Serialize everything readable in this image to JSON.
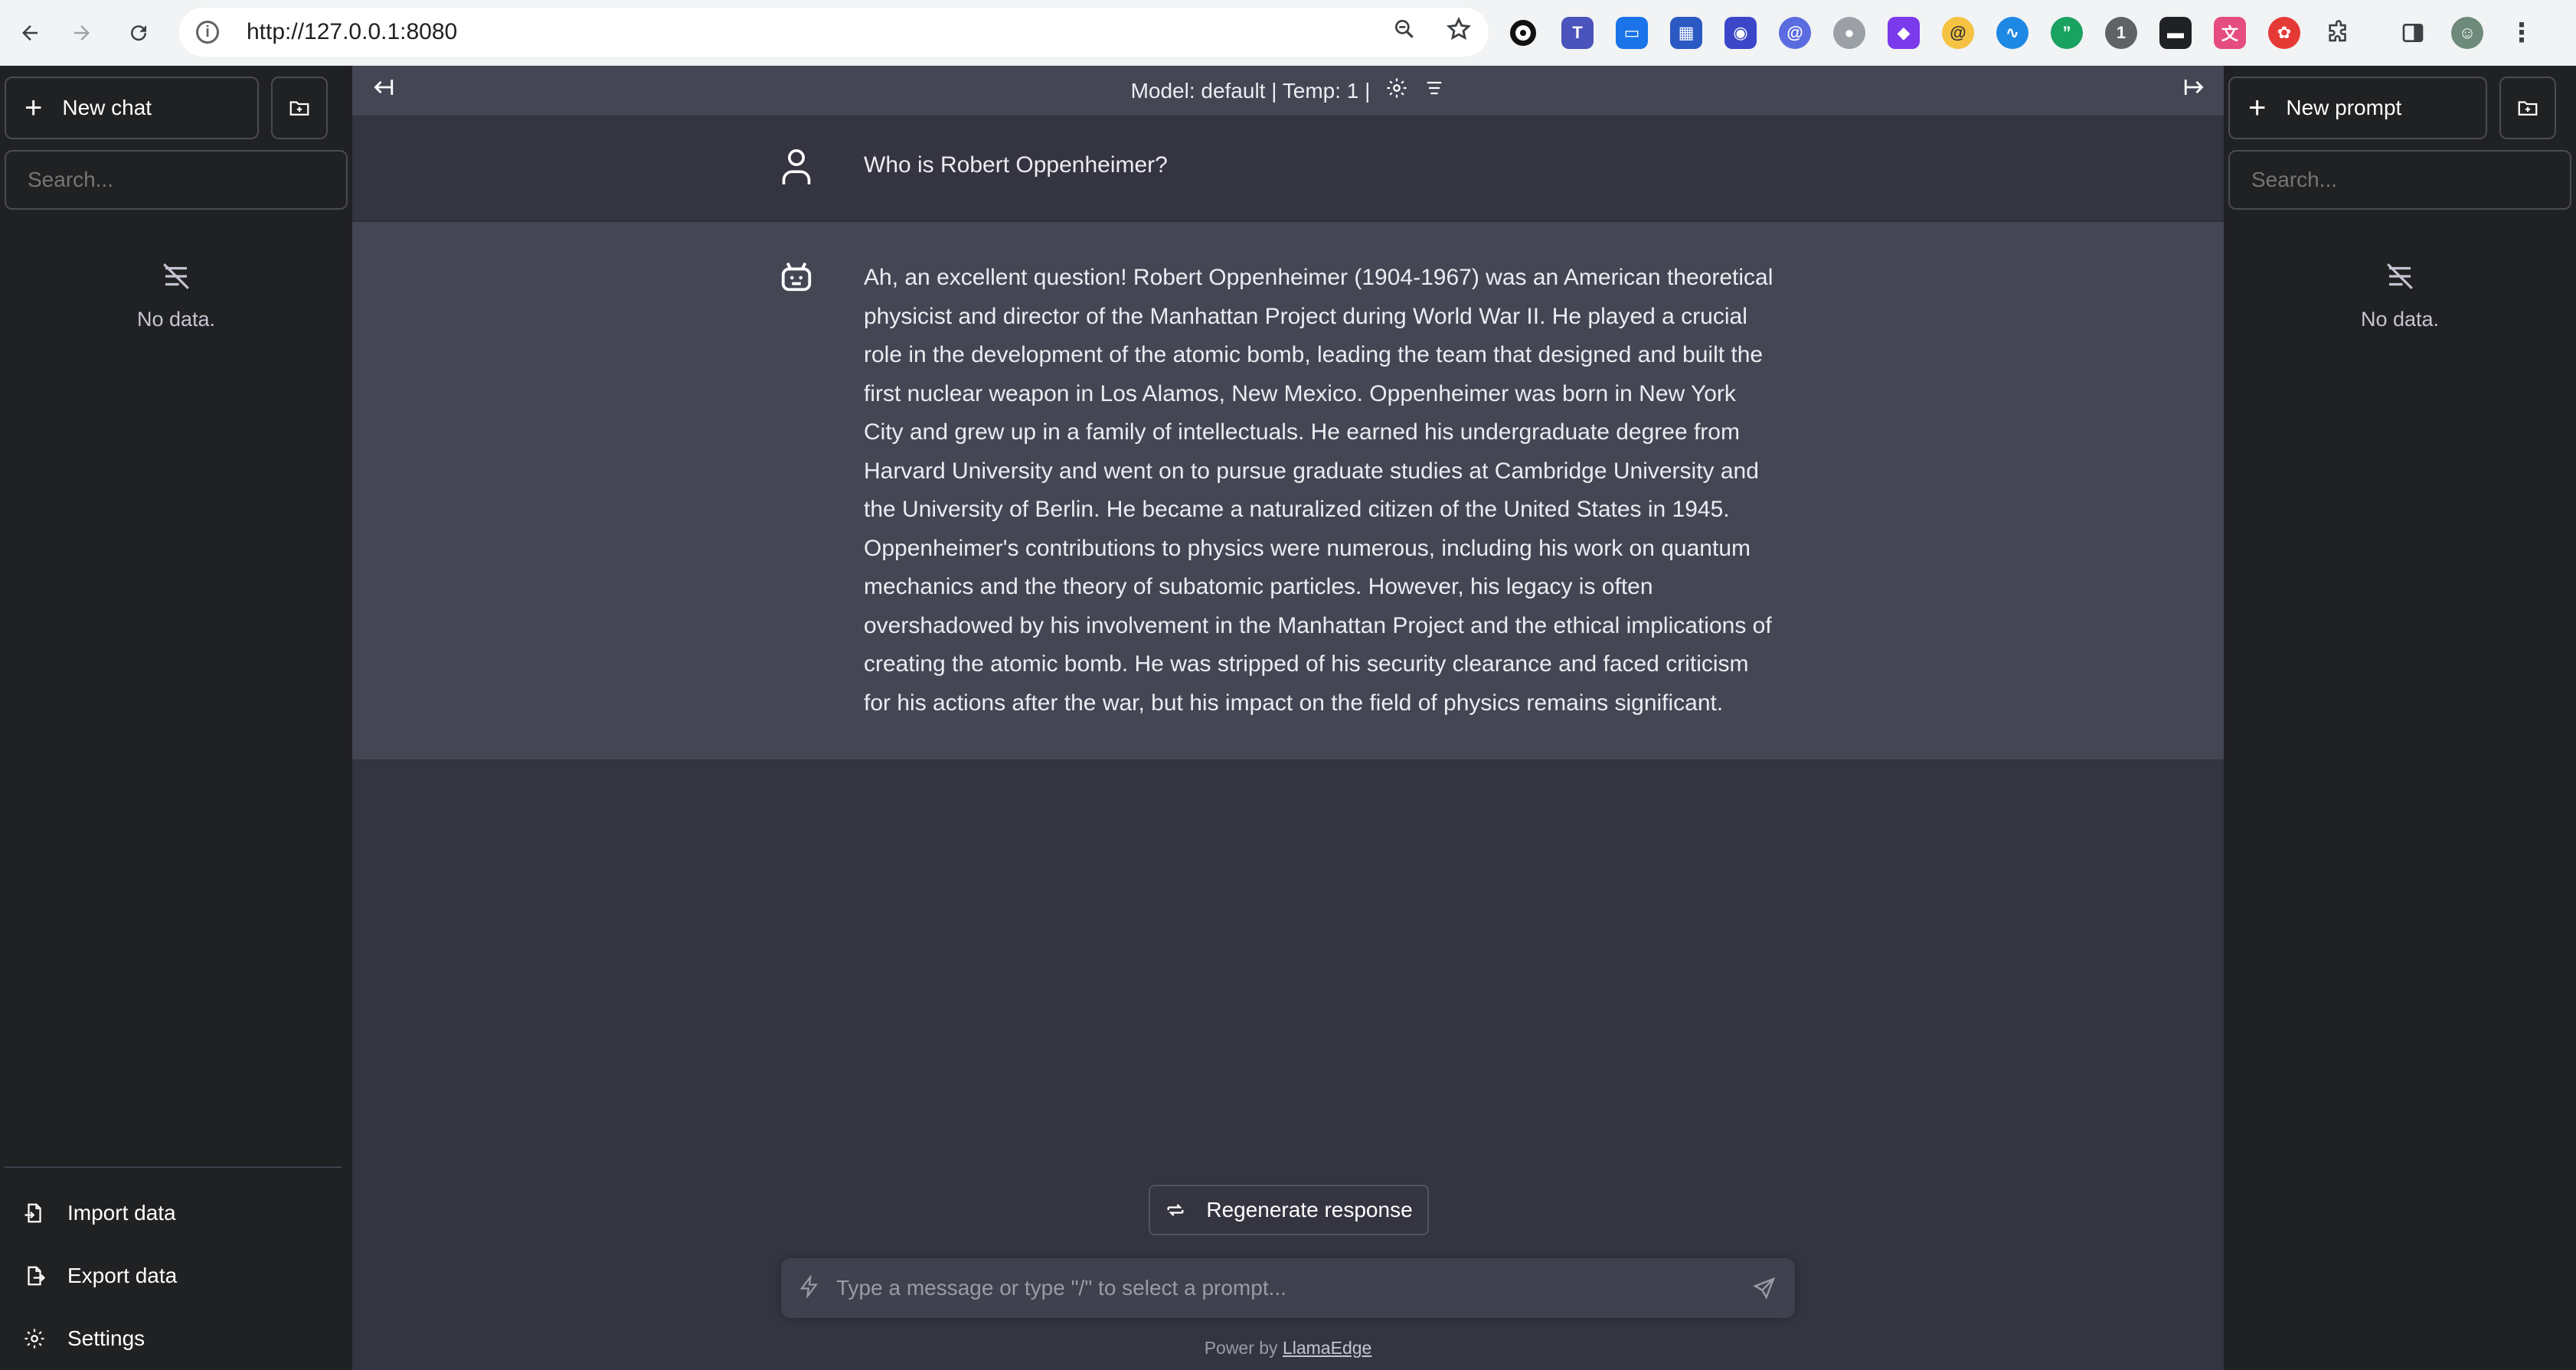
{
  "browser": {
    "url": "http://127.0.0.1:8080",
    "extensions": [
      {
        "icon": "black-circle-ext-icon",
        "color": "#111111"
      },
      {
        "icon": "teams-ext-icon",
        "color": "#4b53bc"
      },
      {
        "icon": "screen-ext-icon",
        "color": "#1a73e8"
      },
      {
        "icon": "tile-ext-icon",
        "color": "#2b59c3"
      },
      {
        "icon": "discord-ext-icon",
        "color": "#3b47c8"
      },
      {
        "icon": "at-ext-icon",
        "color": "#5b6be0"
      },
      {
        "icon": "gray-ext-icon",
        "color": "#9aa0a6"
      },
      {
        "icon": "purple-ext-icon",
        "color": "#7c3aed"
      },
      {
        "icon": "yellow-ext-icon",
        "color": "#f5c242"
      },
      {
        "icon": "wave-ext-icon",
        "color": "#1e88e5"
      },
      {
        "icon": "quote-ext-icon",
        "color": "#1aa260"
      },
      {
        "icon": "one-ext-icon",
        "color": "#5f6368"
      },
      {
        "icon": "terminal-ext-icon",
        "color": "#202124"
      },
      {
        "icon": "pink-ext-icon",
        "color": "#e54d7e"
      },
      {
        "icon": "red-ext-icon",
        "color": "#e53935"
      }
    ]
  },
  "left_sidebar": {
    "new_chat": "New chat",
    "search_placeholder": "Search...",
    "empty": "No data.",
    "bottom": {
      "import": "Import data",
      "export": "Export data",
      "settings": "Settings"
    }
  },
  "right_sidebar": {
    "new_prompt": "New prompt",
    "search_placeholder": "Search...",
    "empty": "No data."
  },
  "model_bar": {
    "text": "Model: default | Temp: 1 |"
  },
  "conversation": {
    "user_message": "Who is Robert Oppenheimer?",
    "bot_message": "Ah, an excellent question! Robert Oppenheimer (1904-1967) was an American theoretical physicist and director of the Manhattan Project during World War II. He played a crucial role in the development of the atomic bomb, leading the team that designed and built the first nuclear weapon in Los Alamos, New Mexico. Oppenheimer was born in New York City and grew up in a family of intellectuals. He earned his undergraduate degree from Harvard University and went on to pursue graduate studies at Cambridge University and the University of Berlin. He became a naturalized citizen of the United States in 1945. Oppenheimer's contributions to physics were numerous, including his work on quantum mechanics and the theory of subatomic particles. However, his legacy is often overshadowed by his involvement in the Manhattan Project and the ethical implications of creating the atomic bomb. He was stripped of his security clearance and faced criticism for his actions after the war, but his impact on the field of physics remains significant."
  },
  "regenerate": "Regenerate response",
  "composer": {
    "placeholder": "Type a message or type \"/\" to select a prompt..."
  },
  "footer": {
    "prefix": "Power by",
    "link": "LlamaEdge"
  }
}
